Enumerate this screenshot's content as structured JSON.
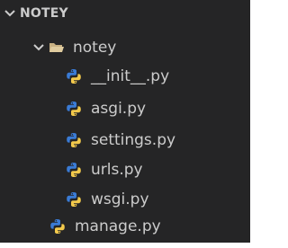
{
  "explorer": {
    "section_title": "NOTEY",
    "folder": {
      "name": "notey"
    },
    "files": [
      {
        "name": "__init__.py",
        "icon": "python-icon"
      },
      {
        "name": "asgi.py",
        "icon": "python-icon"
      },
      {
        "name": "settings.py",
        "icon": "python-icon"
      },
      {
        "name": "urls.py",
        "icon": "python-icon"
      },
      {
        "name": "wsgi.py",
        "icon": "python-icon"
      }
    ],
    "root_file": {
      "name": "manage.py",
      "icon": "python-icon"
    }
  },
  "colors": {
    "panel_bg": "#252526",
    "text": "#cccccc",
    "python_blue": "#3a7bd5",
    "python_yellow": "#f2c94c"
  }
}
